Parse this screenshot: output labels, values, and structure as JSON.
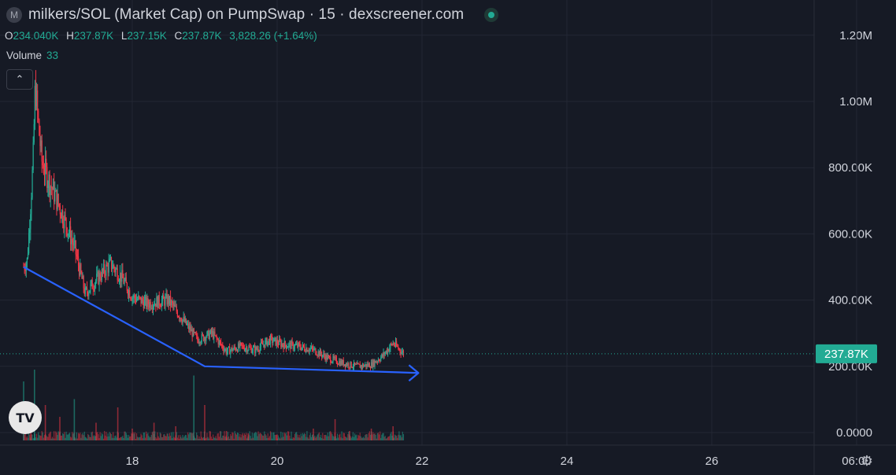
{
  "header": {
    "coin_letter": "M",
    "title": "milkers/SOL (Market Cap) on PumpSwap · 15 · dexscreener.com"
  },
  "ohlc": {
    "o_label": "O",
    "o_value": "234.040K",
    "h_label": "H",
    "h_value": "237.87K",
    "l_label": "L",
    "l_value": "237.15K",
    "c_label": "C",
    "c_value": "237.87K",
    "change": "3,828.26 (+1.64%)"
  },
  "volume": {
    "label": "Volume",
    "value": "33"
  },
  "collapse_icon": "chevron-up-icon",
  "logo_text": "TV",
  "settings_icon": "gear-icon",
  "chart_data": {
    "type": "candlestick",
    "y_ticks": [
      "1.20M",
      "1.00M",
      "800.00K",
      "600.00K",
      "400.00K",
      "200.00K",
      "0.0000"
    ],
    "x_ticks": [
      "18",
      "20",
      "22",
      "24",
      "26",
      "06:00"
    ],
    "ylim": [
      0,
      1200000
    ],
    "grid": true,
    "current_price_label": "237.87K",
    "current_price": 237870,
    "colors": {
      "up": "#22ab94",
      "down": "#f23645",
      "trendline": "#2962ff"
    },
    "price_path": [
      [
        16.5,
        500000
      ],
      [
        16.55,
        520000
      ],
      [
        16.6,
        700000
      ],
      [
        16.63,
        820000
      ],
      [
        16.66,
        1050000
      ],
      [
        16.7,
        940000
      ],
      [
        16.75,
        820000
      ],
      [
        16.85,
        760000
      ],
      [
        17.0,
        680000
      ],
      [
        17.1,
        620000
      ],
      [
        17.2,
        560000
      ],
      [
        17.35,
        420000
      ],
      [
        17.5,
        460000
      ],
      [
        17.7,
        510000
      ],
      [
        17.85,
        470000
      ],
      [
        18.0,
        410000
      ],
      [
        18.2,
        390000
      ],
      [
        18.5,
        400000
      ],
      [
        18.7,
        340000
      ],
      [
        18.9,
        280000
      ],
      [
        19.1,
        300000
      ],
      [
        19.3,
        245000
      ],
      [
        19.5,
        260000
      ],
      [
        19.7,
        250000
      ],
      [
        19.9,
        280000
      ],
      [
        20.1,
        265000
      ],
      [
        20.3,
        260000
      ],
      [
        20.5,
        250000
      ],
      [
        20.7,
        225000
      ],
      [
        20.9,
        210000
      ],
      [
        21.1,
        200000
      ],
      [
        21.3,
        205000
      ],
      [
        21.45,
        230000
      ],
      [
        21.6,
        270000
      ],
      [
        21.75,
        237870
      ]
    ],
    "volume_bars": [
      [
        16.5,
        0.5
      ],
      [
        16.6,
        0.25
      ],
      [
        16.65,
        0.6
      ],
      [
        16.8,
        0.3
      ],
      [
        17.0,
        0.2
      ],
      [
        17.2,
        0.35
      ],
      [
        17.5,
        0.15
      ],
      [
        17.8,
        0.28
      ],
      [
        18.0,
        0.1
      ],
      [
        18.3,
        0.15
      ],
      [
        18.6,
        0.12
      ],
      [
        18.85,
        0.55
      ],
      [
        19.0,
        0.3
      ],
      [
        19.3,
        0.08
      ],
      [
        19.6,
        0.06
      ],
      [
        20.0,
        0.05
      ],
      [
        20.5,
        0.1
      ],
      [
        20.8,
        0.18
      ],
      [
        21.0,
        0.08
      ],
      [
        21.3,
        0.1
      ],
      [
        21.6,
        0.12
      ]
    ],
    "trendline": [
      [
        16.5,
        500000
      ],
      [
        19.0,
        200000
      ],
      [
        21.95,
        180000
      ]
    ]
  }
}
